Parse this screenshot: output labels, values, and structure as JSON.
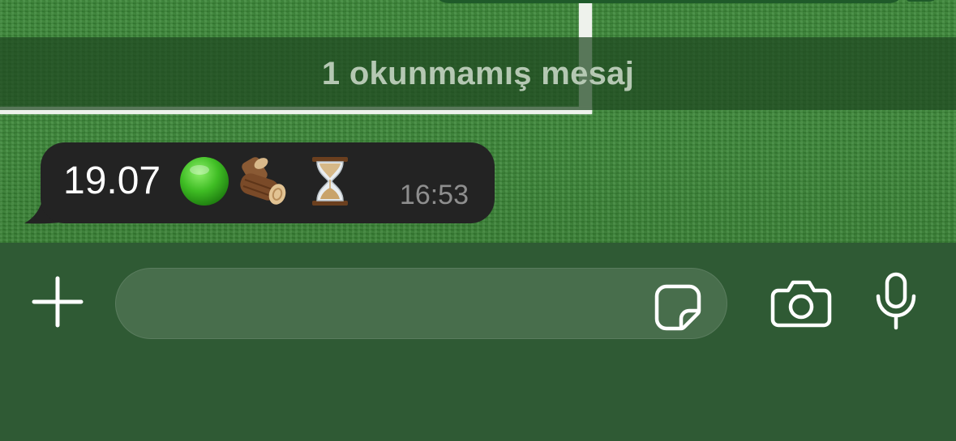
{
  "wallpaper": {
    "theme": "football-pitch-grass",
    "color": "#3f8a3a"
  },
  "unread_banner": {
    "text": "1 okunmamış mesaj"
  },
  "message": {
    "text": "19.07",
    "emojis": [
      "green-circle",
      "wood-log",
      "hourglass"
    ],
    "time": "16:53",
    "bubble_color": "#232323"
  },
  "composer": {
    "input_value": "",
    "icons": [
      "plus-icon",
      "sticker-icon",
      "camera-icon",
      "microphone-icon"
    ],
    "background_color": "#2f5a34"
  }
}
